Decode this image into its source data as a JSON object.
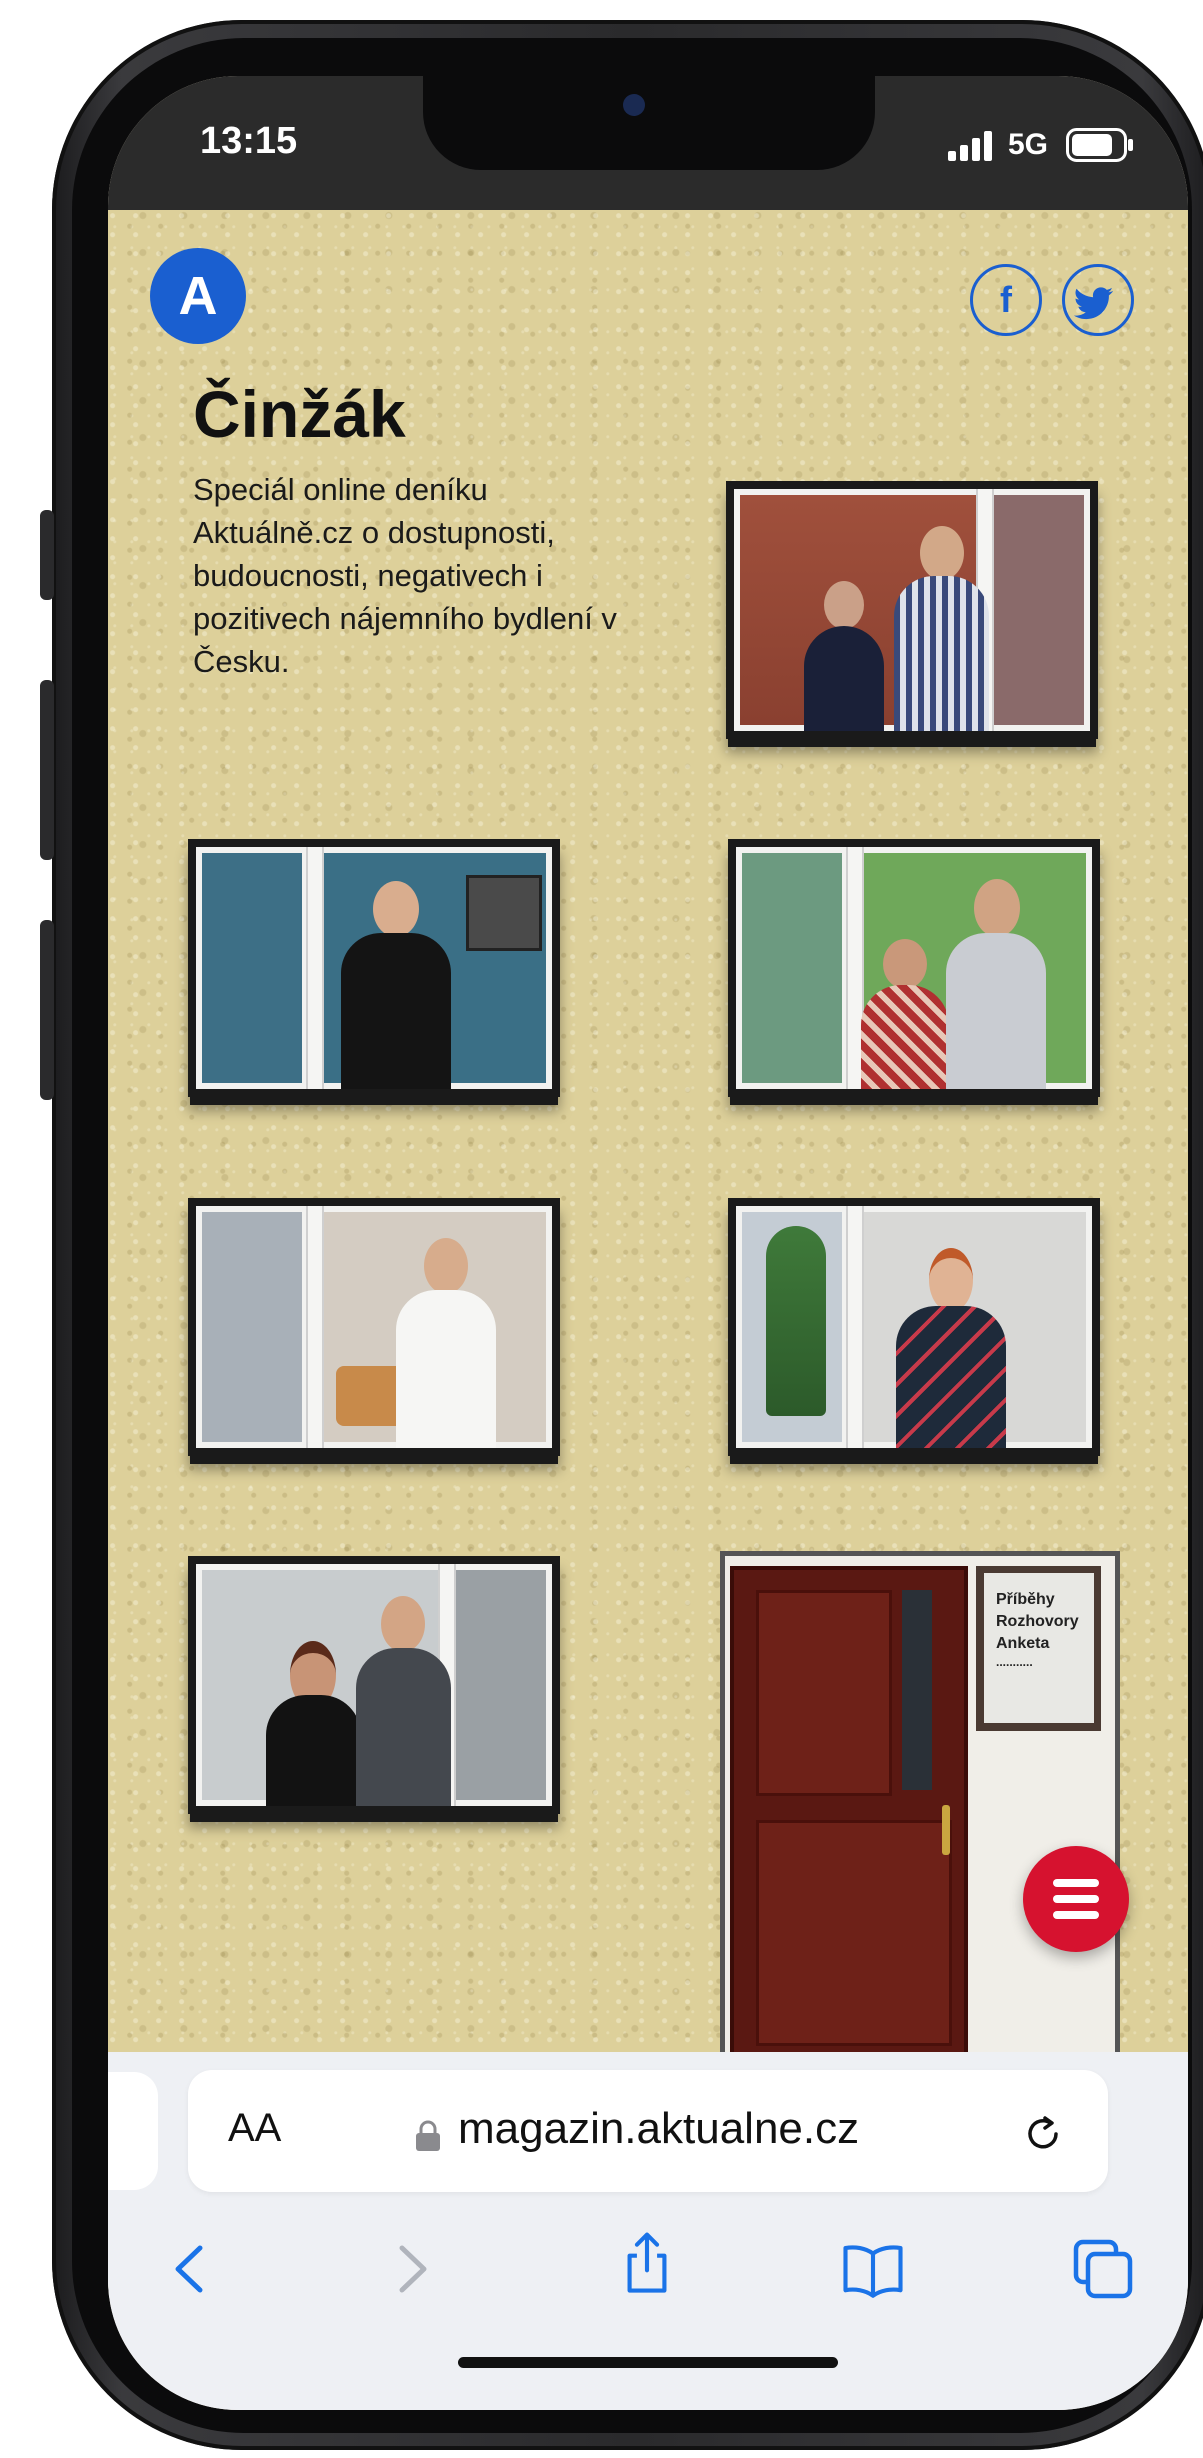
{
  "status_bar": {
    "time": "13:15",
    "network": "5G"
  },
  "site": {
    "logo_letter": "A",
    "social": {
      "facebook": "f",
      "twitter": "t"
    },
    "title": "Činžák",
    "subtitle": "Speciál online deníku Aktuálně.cz o dostupnosti, budoucnosti, negativech i pozitivech nájemního bydlení v Česku."
  },
  "door_sign": {
    "items": [
      "Příběhy",
      "Rozhovory",
      "Anketa",
      "..........."
    ]
  },
  "browser": {
    "text_size_label": "AA",
    "url": "magazin.aktualne.cz"
  },
  "colors": {
    "brand_blue": "#1a5fd0",
    "menu_red": "#d6122f",
    "wall": "#ddd09a",
    "door": "#5a1812"
  },
  "icons": [
    "lock-icon",
    "reload-icon",
    "back-icon",
    "forward-icon",
    "share-icon",
    "bookmarks-icon",
    "tabs-icon",
    "hamburger-icon"
  ]
}
